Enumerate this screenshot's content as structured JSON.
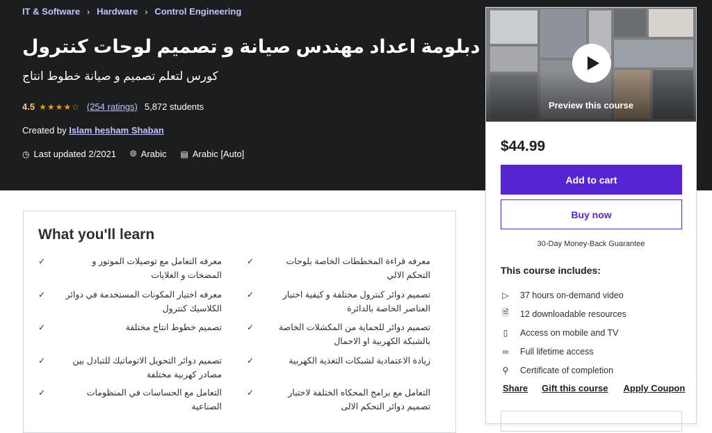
{
  "breadcrumb": [
    "IT & Software",
    "Hardware",
    "Control Engineering"
  ],
  "course": {
    "title": "دبلومة اعداد مهندس صيانة و تصميم لوحات كنترول",
    "subtitle": "كورس لتعلم تصميم و صيانة خطوط انتاج",
    "rating": "4.5",
    "ratings_count": "(254 ratings)",
    "students": "5,872 students",
    "created_by_label": "Created by",
    "instructor": "Islam hesham Shaban",
    "last_updated": "Last updated 2/2021",
    "language": "Arabic",
    "captions": "Arabic [Auto]"
  },
  "sidebar": {
    "preview_label": "Preview this course",
    "price": "$44.99",
    "add_to_cart": "Add to cart",
    "buy_now": "Buy now",
    "guarantee": "30-Day Money-Back Guarantee",
    "includes_title": "This course includes:",
    "includes": [
      {
        "icon": "video-icon",
        "text": "37 hours on-demand video"
      },
      {
        "icon": "file-download-icon",
        "text": "12 downloadable resources"
      },
      {
        "icon": "mobile-icon",
        "text": "Access on mobile and TV"
      },
      {
        "icon": "infinity-icon",
        "text": "Full lifetime access"
      },
      {
        "icon": "trophy-icon",
        "text": "Certificate of completion"
      }
    ],
    "links": {
      "share": "Share",
      "gift": "Gift this course",
      "coupon": "Apply Coupon"
    }
  },
  "learn": {
    "title": "What you'll learn",
    "items": [
      "معرفه قراءة المخططات الخاصة بلوحات التحكم الالي",
      "معرفه التعامل مع توصيلات الموتور و المضخات و الغلايات",
      "تصميم دوائر كنترول مختلفة و كيفية اختيار العناصر الخاصة بالدائرة",
      "معرفه اختيار المكونات المستخدمة في دوائر الكلاسيك كنترول",
      "تصميم دوائر للحماية من المكشلات الخاصة بالشبكة الكهربية او الاحمال",
      "تصميم خطوط انتاج مختلفة",
      "زيادة الاعتمادية لشبكات التغذية الكهربية",
      "تصميم دوائر التحويل الاتوماتيك للتبادل بين مصادر كهربية مختلفة",
      "التعامل مع برامج المحكاه الختلفة لاختبار تصميم دوائر التحكم الالى",
      "التعامل مع الحساسات في المنظومات الصناعية"
    ]
  },
  "colors": {
    "hero_bg": "#1c1d1f",
    "accent": "#5624d0",
    "link": "#c0c4fc",
    "star": "#e59819"
  }
}
